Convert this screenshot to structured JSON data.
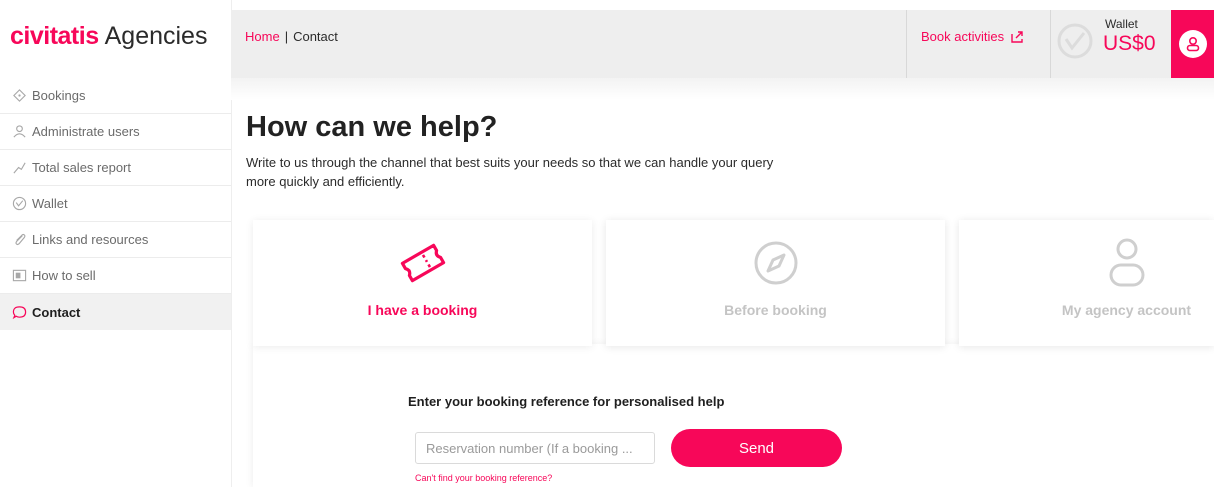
{
  "brand": {
    "name": "civitatis",
    "suffix": "Agencies",
    "accent_color": "#f70759"
  },
  "sidebar": {
    "items": [
      {
        "label": "Bookings",
        "icon": "ticket-icon",
        "active": false
      },
      {
        "label": "Administrate users",
        "icon": "users-icon",
        "active": false
      },
      {
        "label": "Total sales report",
        "icon": "sales-chart-icon",
        "active": false
      },
      {
        "label": "Wallet",
        "icon": "wallet-icon",
        "active": false
      },
      {
        "label": "Links and resources",
        "icon": "paperclip-icon",
        "active": false
      },
      {
        "label": "How to sell",
        "icon": "presentation-icon",
        "active": false
      },
      {
        "label": "Contact",
        "icon": "chat-bubble-icon",
        "active": true
      }
    ]
  },
  "header": {
    "breadcrumb": {
      "home": "Home",
      "separator": "|",
      "current": "Contact"
    },
    "book_activities": "Book activities",
    "wallet": {
      "label": "Wallet",
      "amount": "US$0"
    }
  },
  "main": {
    "title": "How can we help?",
    "intro": "Write to us through the channel that best suits your needs so that we can handle your query more quickly and efficiently.",
    "cards": [
      {
        "label": "I have a booking",
        "icon": "ticket-icon",
        "active": true
      },
      {
        "label": "Before booking",
        "icon": "compass-icon",
        "active": false
      },
      {
        "label": "My agency account",
        "icon": "user-icon",
        "active": false
      }
    ],
    "booking_form": {
      "heading": "Enter your booking reference for personalised help",
      "input_placeholder": "Reservation number (If a booking ...",
      "input_value": "",
      "send_label": "Send",
      "help_link": "Can't find your booking reference?"
    }
  }
}
